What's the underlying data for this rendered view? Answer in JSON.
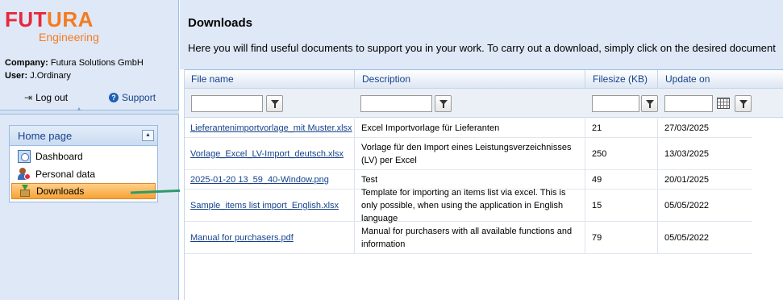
{
  "brand": {
    "name_part1": "FUT",
    "name_part2": "URA",
    "subtitle": "Engineering",
    "colors": {
      "red": "#e8283c",
      "orange": "#f47b20"
    }
  },
  "account": {
    "company_label": "Company:",
    "company_value": "Futura Solutions GmbH",
    "user_label": "User:",
    "user_value": "J.Ordinary"
  },
  "actions": {
    "logout_label": "Log out",
    "support_label": "Support"
  },
  "nav": {
    "header": "Home page",
    "items": [
      {
        "label": "Dashboard",
        "icon": "dashboard-icon"
      },
      {
        "label": "Personal data",
        "icon": "personal-data-icon"
      },
      {
        "label": "Downloads",
        "icon": "downloads-icon",
        "selected": true
      }
    ]
  },
  "page": {
    "title": "Downloads",
    "intro": "Here you will find useful documents to support you in your work. To carry out a download, simply click on the desired document"
  },
  "grid": {
    "columns": [
      "File name",
      "Description",
      "Filesize (KB)",
      "Update on"
    ],
    "rows": [
      {
        "file": "Lieferantenimportvorlage_mit Muster.xlsx",
        "description": "Excel Importvorlage für Lieferanten",
        "size": "21",
        "updated": "27/03/2025"
      },
      {
        "file": "Vorlage_Excel_LV-Import_deutsch.xlsx",
        "description": "Vorlage für den Import eines Leistungsverzeichnisses (LV) per Excel",
        "size": "250",
        "updated": "13/03/2025"
      },
      {
        "file": "2025-01-20 13_59_40-Window.png",
        "description": "Test",
        "size": "49",
        "updated": "20/01/2025"
      },
      {
        "file": "Sample_items list import_English.xlsx",
        "description": "Template for importing an items list via excel. This is only possible, when using the application in English language",
        "size": "15",
        "updated": "05/05/2022"
      },
      {
        "file": "Manual for purchasers.pdf",
        "description": "Manual for purchasers with all available functions and information",
        "size": "79",
        "updated": "05/05/2022"
      }
    ]
  },
  "colors": {
    "sidebar_bg": "#dfe8f6",
    "header_text": "#15428b",
    "selected_item": "#f7a234",
    "annotation_arrow": "#2e9a6a"
  }
}
